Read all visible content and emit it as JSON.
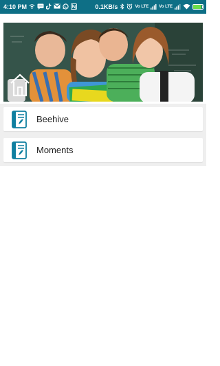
{
  "status_bar": {
    "time": "4:10 PM",
    "left_icons": [
      "wifi-calling-icon",
      "chat-icon",
      "tiktok-icon",
      "gmail-icon",
      "whatsapp-icon",
      "n-icon"
    ],
    "net_speed": "0.1KB/s",
    "volte_1": "Vo LTE",
    "volte_2": "Vo LTE",
    "right_icons": [
      "bluetooth-icon",
      "alarm-icon",
      "signal-1-icon",
      "signal-2-icon",
      "wifi-icon",
      "battery-icon"
    ],
    "battery_level": 0.85,
    "colors": {
      "background": "#0e6f86",
      "battery": "#6dde4a"
    }
  },
  "banner": {
    "image": "students-classroom-photo"
  },
  "list": {
    "items": [
      {
        "label": "Beehive",
        "icon": "book-icon"
      },
      {
        "label": "Moments",
        "icon": "book-icon"
      }
    ],
    "accent_color": "#0e7fa0"
  }
}
